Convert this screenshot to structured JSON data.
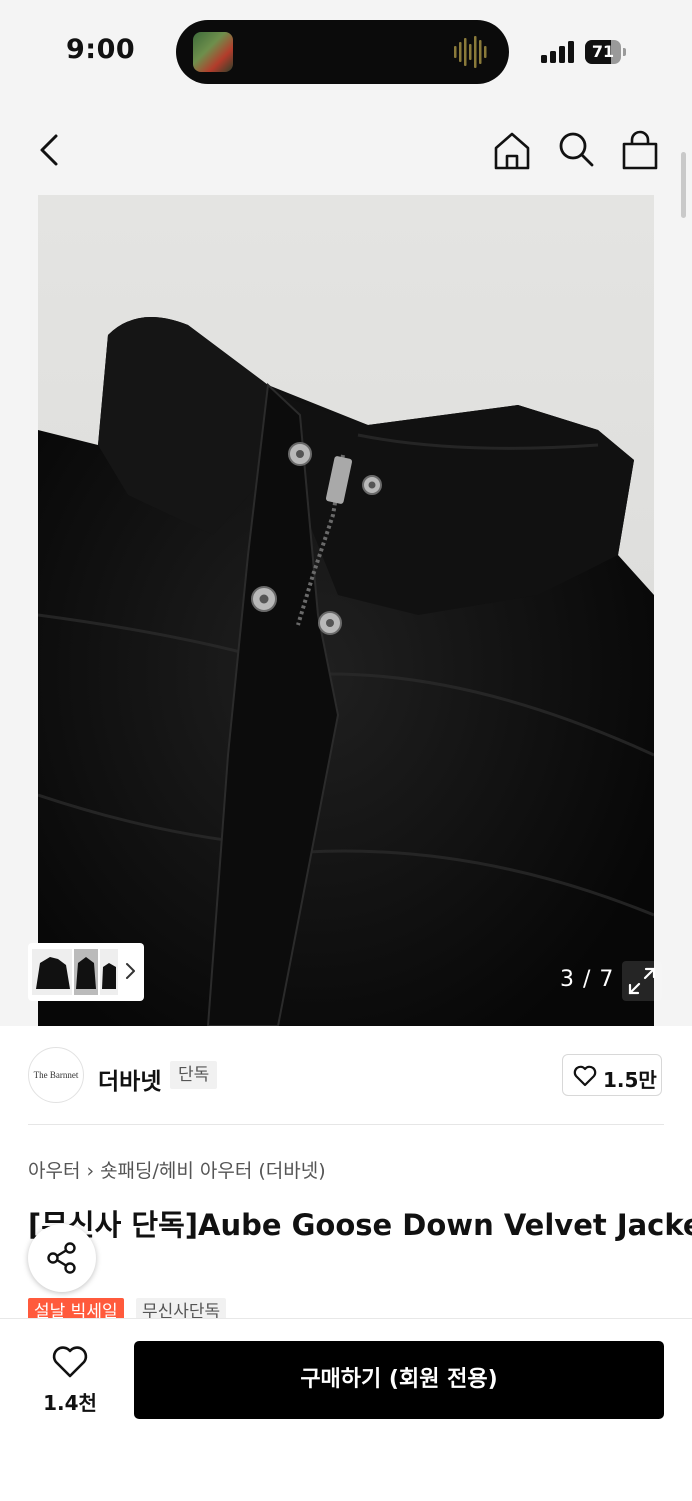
{
  "status_bar": {
    "time": "9:00",
    "battery_level": "71",
    "battery_fraction": 0.71
  },
  "gallery": {
    "counter": "3 / 7"
  },
  "brand": {
    "logo_text": "The Barnnet",
    "name": "더바넷",
    "badge": "단독",
    "like_count": "1.5만"
  },
  "breadcrumb": {
    "items": [
      "아우터",
      "숏패딩/헤비 아우터 (더바넷)"
    ]
  },
  "product": {
    "title": "[무신사 단독]Aube Goose Down Velvet Jacke",
    "tags": [
      "설날 빅세일",
      "무신사단독"
    ]
  },
  "bottom_bar": {
    "like_count": "1.4천",
    "buy_label": "구매하기 (회원 전용)"
  },
  "icons": [
    "back-chevron-icon",
    "home-icon",
    "search-icon",
    "shopping-bag-icon",
    "expand-icon",
    "heart-icon",
    "share-icon"
  ]
}
